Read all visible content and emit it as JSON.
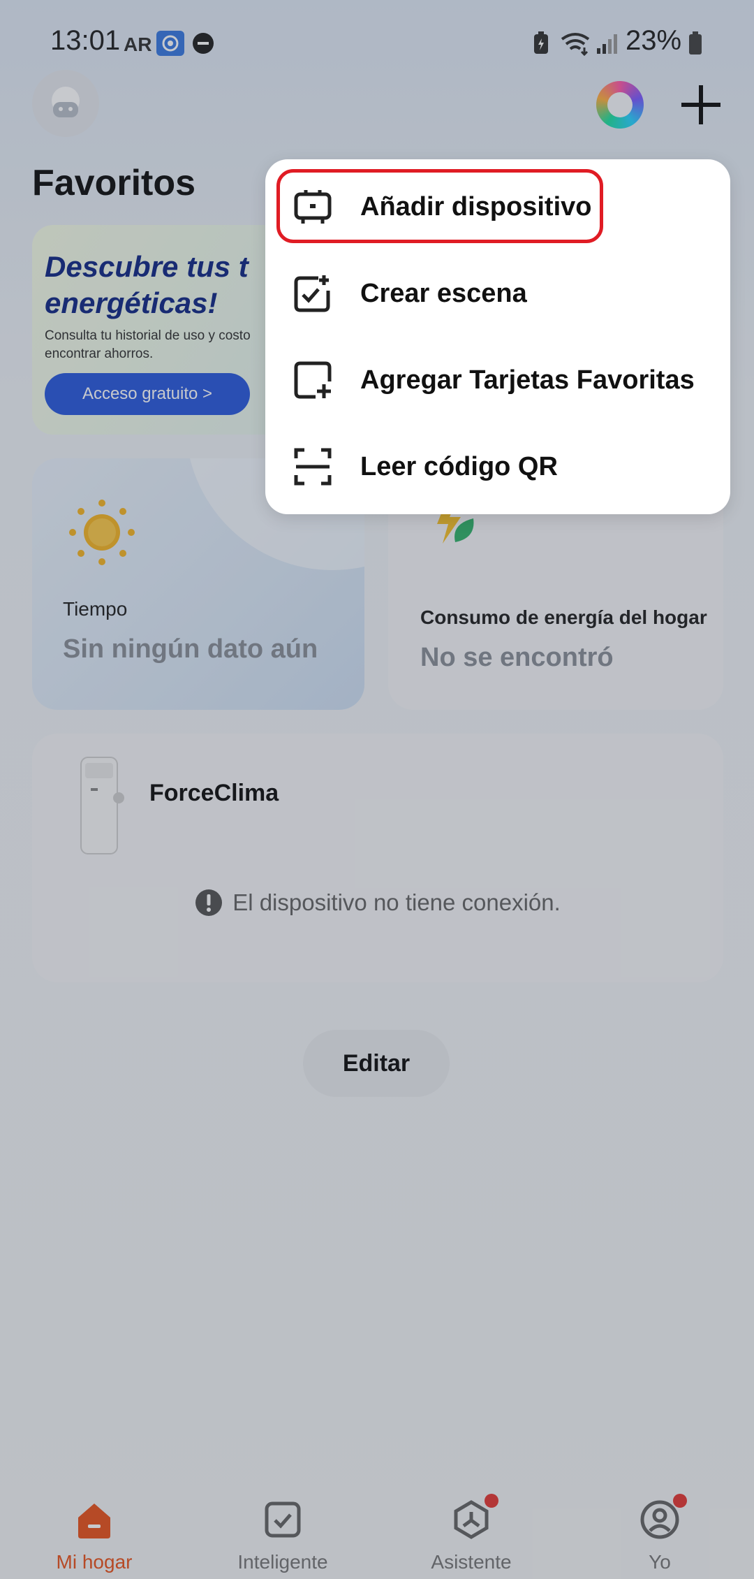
{
  "status_bar": {
    "time": "13:01",
    "battery": "23%"
  },
  "header": {
    "title": "Favoritos"
  },
  "banner": {
    "title": "Descubre tus t\nenergéticas!",
    "subtitle": "Consulta tu historial de uso y costo\nencontrar ahorros.",
    "button_label": "Acceso gratuito >"
  },
  "cards": {
    "weather": {
      "label": "Tiempo",
      "value": "Sin ningún dato aún"
    },
    "energy": {
      "label": "Consumo de energía del hogar",
      "value": "No se encontró"
    }
  },
  "device": {
    "name": "ForceClima",
    "status": "El dispositivo no tiene conexión."
  },
  "edit_button": "Editar",
  "menu": {
    "items": [
      {
        "label": "Añadir dispositivo",
        "icon": "device-add-icon"
      },
      {
        "label": "Crear escena",
        "icon": "scene-create-icon"
      },
      {
        "label": "Agregar Tarjetas Favoritas",
        "icon": "card-add-icon"
      },
      {
        "label": "Leer código QR",
        "icon": "qr-scan-icon"
      }
    ],
    "highlight_color": "#e01c24"
  },
  "bottom_nav": {
    "items": [
      {
        "label": "Mi hogar",
        "active": true,
        "color": "#e8541e"
      },
      {
        "label": "Inteligente",
        "active": false
      },
      {
        "label": "Asistente",
        "active": false,
        "badge": true
      },
      {
        "label": "Yo",
        "active": false,
        "badge": true
      }
    ]
  }
}
